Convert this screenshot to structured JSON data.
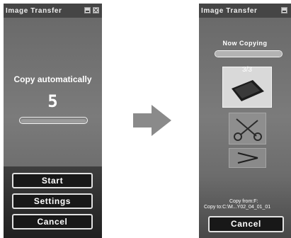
{
  "auto_window": {
    "title": "Image Transfer",
    "message": "Copy automatically",
    "countdown": "5",
    "buttons": {
      "start": "Start",
      "settings": "Settings",
      "cancel": "Cancel"
    }
  },
  "copy_window": {
    "title": "Image Transfer",
    "status": "Now Copying",
    "progress": 1.0,
    "counter": "3/3",
    "copy_from": "Copy from:F:",
    "copy_to": "Copy to:C:\\M...Y02_04_01_01",
    "buttons": {
      "cancel": "Cancel"
    }
  },
  "icons": {
    "minimize": "minimize-icon",
    "close": "close-icon",
    "arrow": "arrow-right-icon"
  },
  "colors": {
    "window_bg": "#4a4a4a",
    "button_bg": "#181818",
    "button_border": "#e2e2e2",
    "text": "#ffffff"
  }
}
